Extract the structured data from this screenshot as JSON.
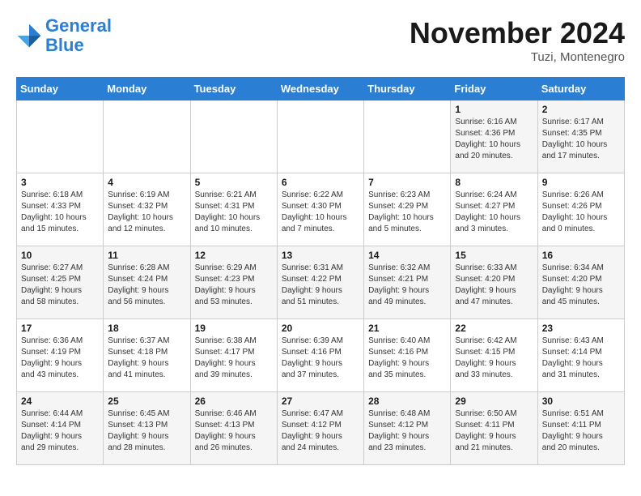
{
  "logo": {
    "line1": "General",
    "line2": "Blue"
  },
  "title": "November 2024",
  "location": "Tuzi, Montenegro",
  "days_header": [
    "Sunday",
    "Monday",
    "Tuesday",
    "Wednesday",
    "Thursday",
    "Friday",
    "Saturday"
  ],
  "weeks": [
    [
      {
        "day": "",
        "info": ""
      },
      {
        "day": "",
        "info": ""
      },
      {
        "day": "",
        "info": ""
      },
      {
        "day": "",
        "info": ""
      },
      {
        "day": "",
        "info": ""
      },
      {
        "day": "1",
        "info": "Sunrise: 6:16 AM\nSunset: 4:36 PM\nDaylight: 10 hours\nand 20 minutes."
      },
      {
        "day": "2",
        "info": "Sunrise: 6:17 AM\nSunset: 4:35 PM\nDaylight: 10 hours\nand 17 minutes."
      }
    ],
    [
      {
        "day": "3",
        "info": "Sunrise: 6:18 AM\nSunset: 4:33 PM\nDaylight: 10 hours\nand 15 minutes."
      },
      {
        "day": "4",
        "info": "Sunrise: 6:19 AM\nSunset: 4:32 PM\nDaylight: 10 hours\nand 12 minutes."
      },
      {
        "day": "5",
        "info": "Sunrise: 6:21 AM\nSunset: 4:31 PM\nDaylight: 10 hours\nand 10 minutes."
      },
      {
        "day": "6",
        "info": "Sunrise: 6:22 AM\nSunset: 4:30 PM\nDaylight: 10 hours\nand 7 minutes."
      },
      {
        "day": "7",
        "info": "Sunrise: 6:23 AM\nSunset: 4:29 PM\nDaylight: 10 hours\nand 5 minutes."
      },
      {
        "day": "8",
        "info": "Sunrise: 6:24 AM\nSunset: 4:27 PM\nDaylight: 10 hours\nand 3 minutes."
      },
      {
        "day": "9",
        "info": "Sunrise: 6:26 AM\nSunset: 4:26 PM\nDaylight: 10 hours\nand 0 minutes."
      }
    ],
    [
      {
        "day": "10",
        "info": "Sunrise: 6:27 AM\nSunset: 4:25 PM\nDaylight: 9 hours\nand 58 minutes."
      },
      {
        "day": "11",
        "info": "Sunrise: 6:28 AM\nSunset: 4:24 PM\nDaylight: 9 hours\nand 56 minutes."
      },
      {
        "day": "12",
        "info": "Sunrise: 6:29 AM\nSunset: 4:23 PM\nDaylight: 9 hours\nand 53 minutes."
      },
      {
        "day": "13",
        "info": "Sunrise: 6:31 AM\nSunset: 4:22 PM\nDaylight: 9 hours\nand 51 minutes."
      },
      {
        "day": "14",
        "info": "Sunrise: 6:32 AM\nSunset: 4:21 PM\nDaylight: 9 hours\nand 49 minutes."
      },
      {
        "day": "15",
        "info": "Sunrise: 6:33 AM\nSunset: 4:20 PM\nDaylight: 9 hours\nand 47 minutes."
      },
      {
        "day": "16",
        "info": "Sunrise: 6:34 AM\nSunset: 4:20 PM\nDaylight: 9 hours\nand 45 minutes."
      }
    ],
    [
      {
        "day": "17",
        "info": "Sunrise: 6:36 AM\nSunset: 4:19 PM\nDaylight: 9 hours\nand 43 minutes."
      },
      {
        "day": "18",
        "info": "Sunrise: 6:37 AM\nSunset: 4:18 PM\nDaylight: 9 hours\nand 41 minutes."
      },
      {
        "day": "19",
        "info": "Sunrise: 6:38 AM\nSunset: 4:17 PM\nDaylight: 9 hours\nand 39 minutes."
      },
      {
        "day": "20",
        "info": "Sunrise: 6:39 AM\nSunset: 4:16 PM\nDaylight: 9 hours\nand 37 minutes."
      },
      {
        "day": "21",
        "info": "Sunrise: 6:40 AM\nSunset: 4:16 PM\nDaylight: 9 hours\nand 35 minutes."
      },
      {
        "day": "22",
        "info": "Sunrise: 6:42 AM\nSunset: 4:15 PM\nDaylight: 9 hours\nand 33 minutes."
      },
      {
        "day": "23",
        "info": "Sunrise: 6:43 AM\nSunset: 4:14 PM\nDaylight: 9 hours\nand 31 minutes."
      }
    ],
    [
      {
        "day": "24",
        "info": "Sunrise: 6:44 AM\nSunset: 4:14 PM\nDaylight: 9 hours\nand 29 minutes."
      },
      {
        "day": "25",
        "info": "Sunrise: 6:45 AM\nSunset: 4:13 PM\nDaylight: 9 hours\nand 28 minutes."
      },
      {
        "day": "26",
        "info": "Sunrise: 6:46 AM\nSunset: 4:13 PM\nDaylight: 9 hours\nand 26 minutes."
      },
      {
        "day": "27",
        "info": "Sunrise: 6:47 AM\nSunset: 4:12 PM\nDaylight: 9 hours\nand 24 minutes."
      },
      {
        "day": "28",
        "info": "Sunrise: 6:48 AM\nSunset: 4:12 PM\nDaylight: 9 hours\nand 23 minutes."
      },
      {
        "day": "29",
        "info": "Sunrise: 6:50 AM\nSunset: 4:11 PM\nDaylight: 9 hours\nand 21 minutes."
      },
      {
        "day": "30",
        "info": "Sunrise: 6:51 AM\nSunset: 4:11 PM\nDaylight: 9 hours\nand 20 minutes."
      }
    ]
  ]
}
